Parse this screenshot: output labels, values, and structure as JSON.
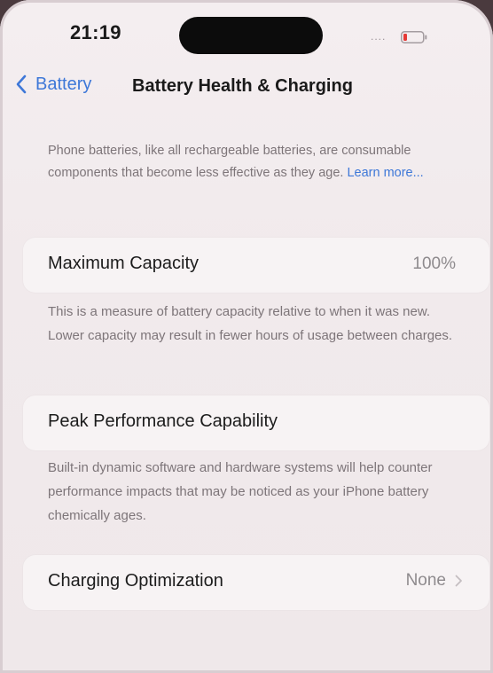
{
  "status_bar": {
    "time": "21:19",
    "signal_dots": "....",
    "battery_icon": "battery-low-icon"
  },
  "nav": {
    "back_label": "Battery",
    "title": "Battery Health & Charging"
  },
  "intro": {
    "text": "Phone batteries, like all rechargeable batteries, are consumable components that become less effective as they age.",
    "learn_more": "Learn more..."
  },
  "maximum_capacity": {
    "label": "Maximum Capacity",
    "value": "100%",
    "description": "This is a measure of battery capacity relative to when it was new. Lower capacity may result in fewer hours of usage between charges."
  },
  "peak_performance": {
    "label": "Peak Performance Capability",
    "description": "Built-in dynamic software and hardware systems will help counter performance impacts that may be noticed as your iPhone battery chemically ages."
  },
  "charging_optimization": {
    "label": "Charging Optimization",
    "value": "None"
  },
  "colors": {
    "accent": "#3e78d8",
    "battery_low": "#e53935",
    "background": "#f2ebed",
    "cell_background": "#f7f3f4"
  }
}
